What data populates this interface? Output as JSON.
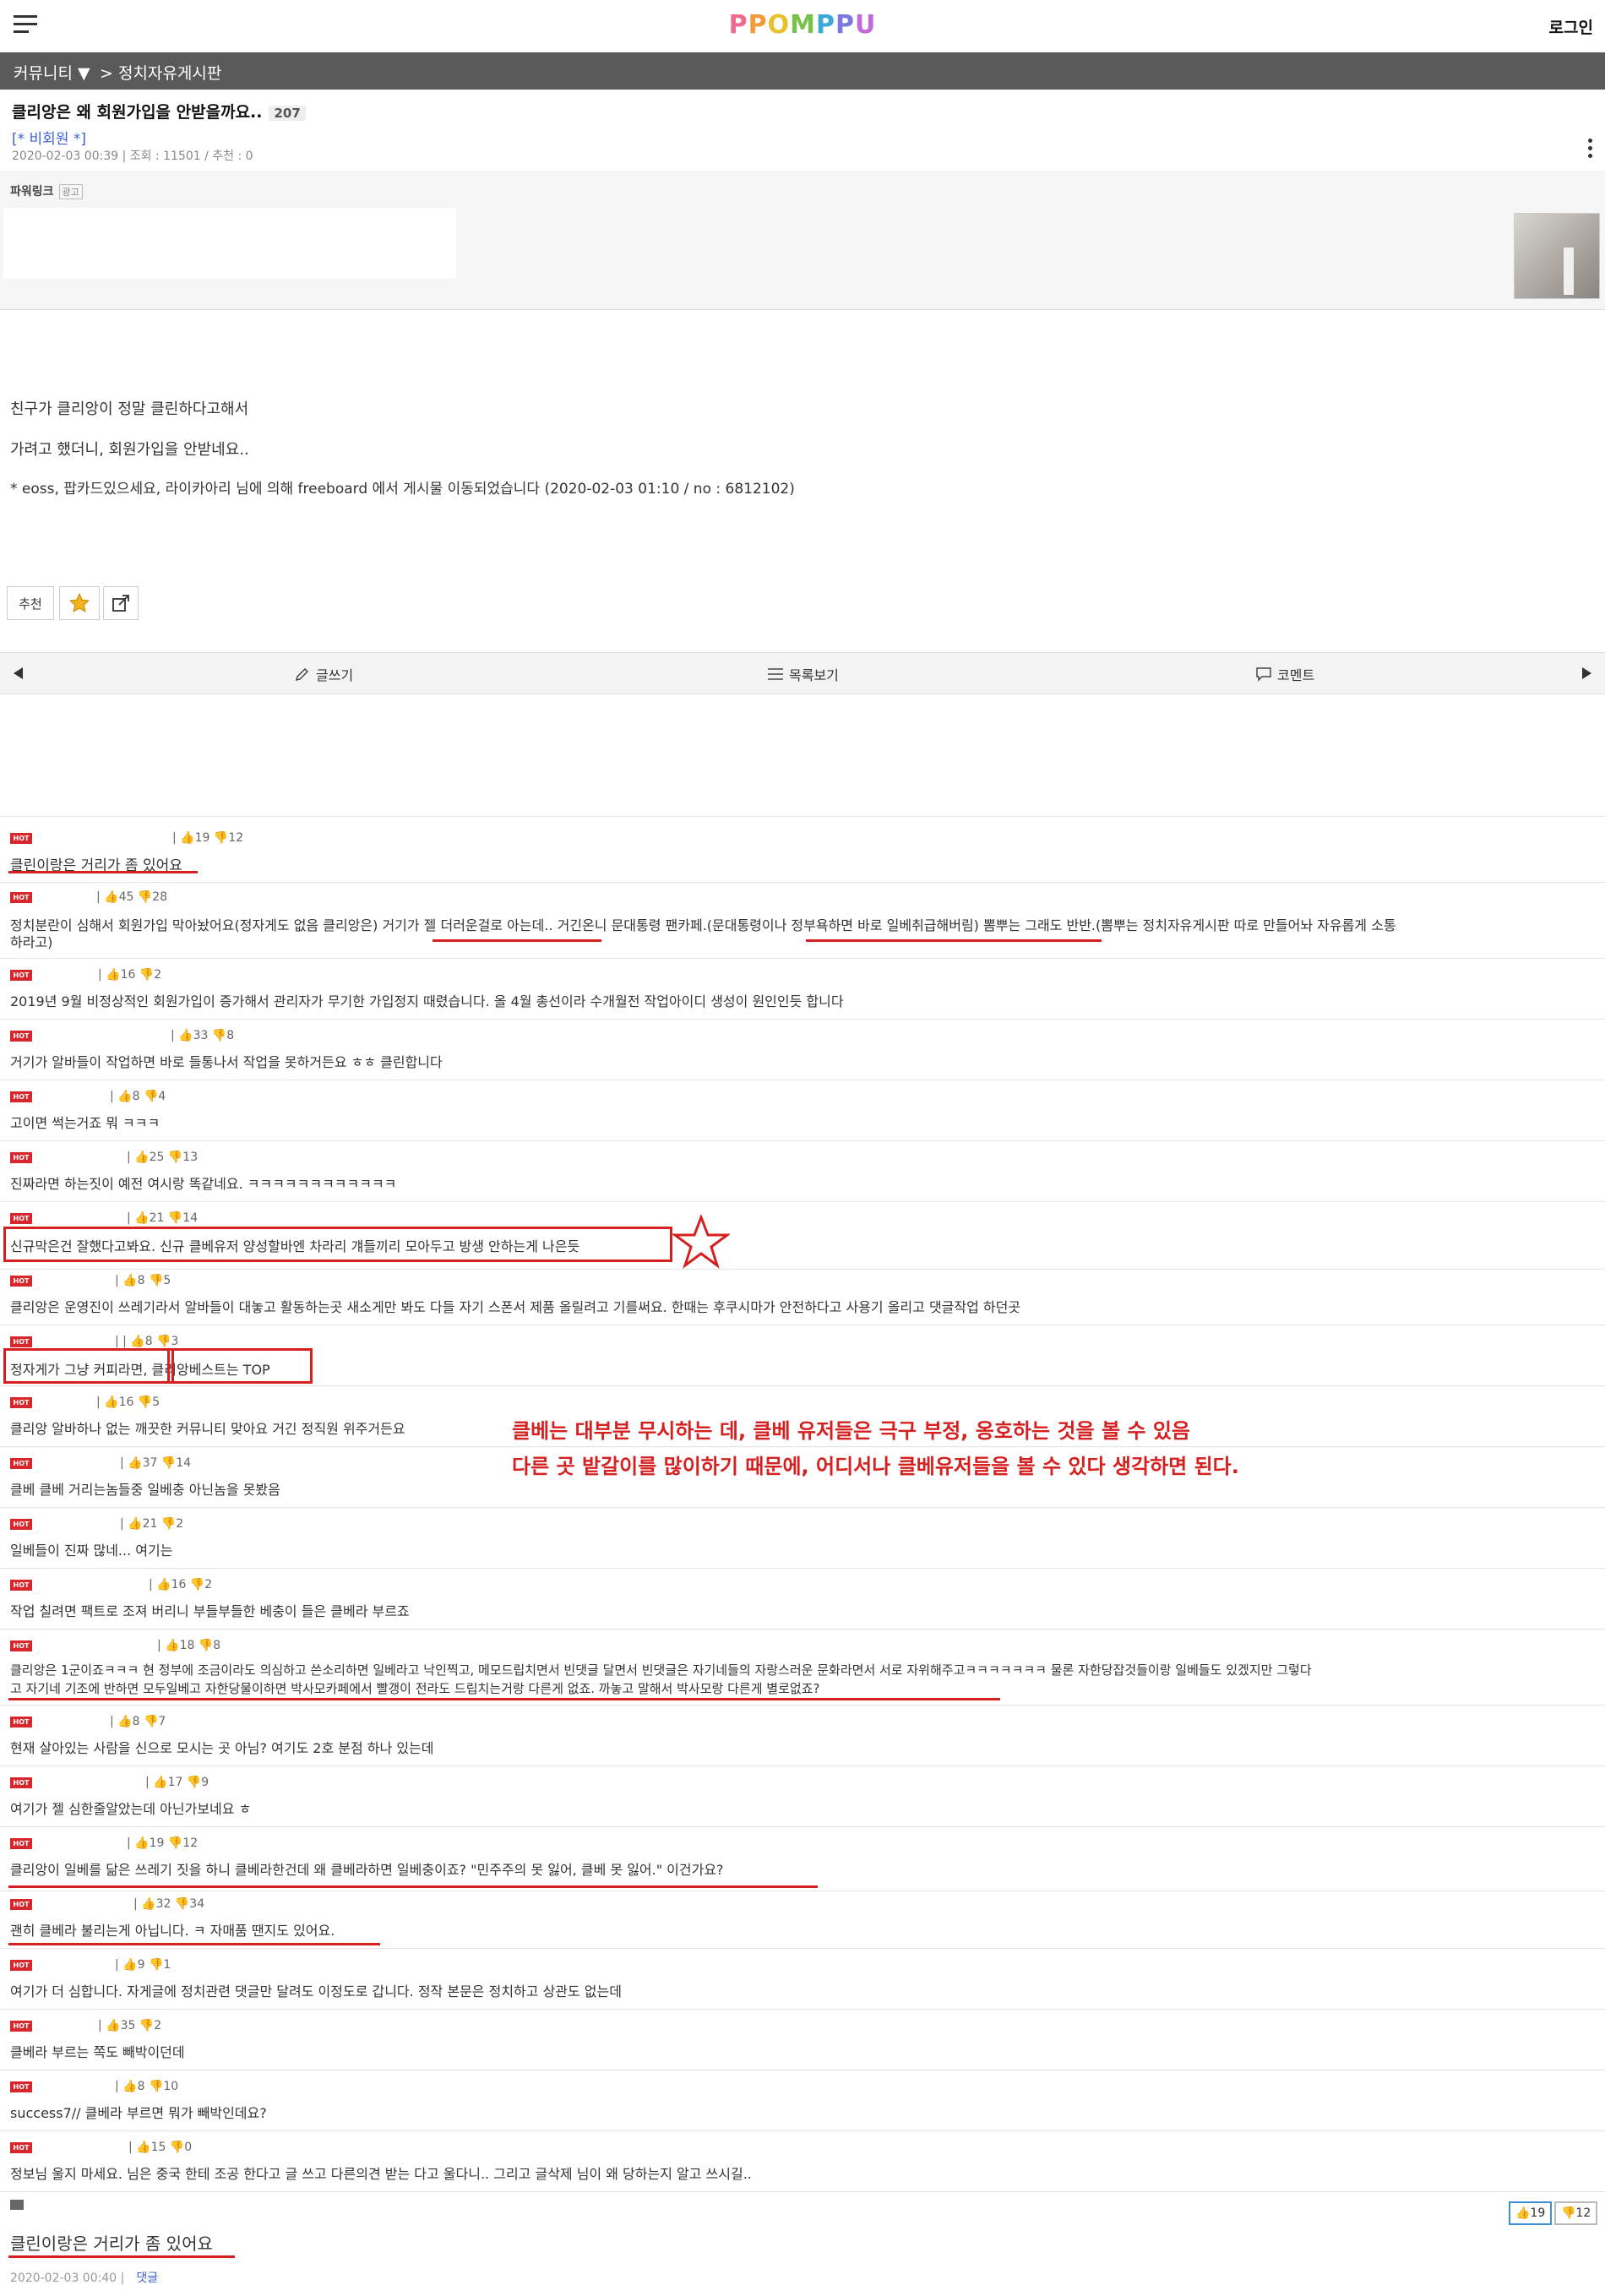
{
  "header": {
    "logo_text": "PPOMPPU",
    "login_label": "로그인",
    "brand_colors": [
      "#f06a8f",
      "#f29b3b",
      "#e7c22d",
      "#79c24a",
      "#3aa8d8",
      "#7b78e0",
      "#c06adb"
    ]
  },
  "breadcrumb": {
    "community": "커뮤니티 ▼",
    "board": "> 정치자유게시판"
  },
  "post": {
    "title": "클리앙은 왜 회원가입을 안받을까요..",
    "comment_count": "207",
    "author": "[* 비회원 *]",
    "meta": "2020-02-03 00:39 | 조회 : 11501 / 추천 : 0",
    "body": [
      "친구가 클리앙이 정말 클린하다고해서",
      "가려고 했더니, 회원가입을 안받네요..",
      "* eoss, 팝카드있으세요, 라이카아리 님에 의해 freeboard 에서 게시물 이동되었습니다 (2020-02-03 01:10 / no : 6812102)"
    ]
  },
  "ad": {
    "label": "파워링크",
    "tag": "광고"
  },
  "actions": {
    "recommend_label": "추천"
  },
  "nav": {
    "write_label": "글쓰기",
    "list_label": "목록보기",
    "comment_label": "코멘트"
  },
  "comments": [
    {
      "hot": "HOT",
      "votes": "| 👍19 👎12",
      "text": "클린이랑은 거리가 좀 있어요"
    },
    {
      "hot": "HOT",
      "votes": "| 👍45 👎28",
      "text": "정치분란이 심해서 회원가입 막아놨어요(정자게도 없음 클리앙은) 거기가 젤 더러운걸로 아는데.. 거긴온니 문대통령 팬카페.(문대통령이나 정부욕하면 바로 일베취급해버림) 뽐뿌는 그래도 반반.(뽐뿌는 정치자유게시판 따로 만들어놔 자유롭게 소통"
    },
    {
      "hot": "HOT",
      "votes": "| 👍16 👎2",
      "text": "2019년 9월 비정상적인 회원가입이 증가해서 관리자가 무기한 가입정지 때렸습니다. 올 4월 총선이라 수개월전 작업아이디 생성이 원인인듯 합니다"
    },
    {
      "hot": "HOT",
      "votes": "| 👍33 👎8",
      "text": "거기가 알바들이 작업하면 바로 들통나서 작업을 못하거든요 ㅎㅎ 클린합니다"
    },
    {
      "hot": "HOT",
      "votes": "| 👍8 👎4",
      "text": "고이면 썩는거죠 뭐 ㅋㅋㅋ"
    },
    {
      "hot": "HOT",
      "votes": "| 👍25 👎13",
      "text": "진짜라면 하는짓이 예전 여시랑 똑같네요. ㅋㅋㅋㅋㅋㅋㅋㅋㅋㅋㅋㅋ"
    },
    {
      "hot": "HOT",
      "votes": "| 👍21 👎14",
      "text": "신규막은건 잘했다고봐요. 신규 클베유저 양성할바엔 차라리 걔들끼리 모아두고 방생 안하는게 나은듯"
    },
    {
      "hot": "HOT",
      "votes": "| 👍8 👎5",
      "text": "클리앙은 운영진이 쓰레기라서 알바들이 대놓고 활동하는곳 새소게만 봐도 다들 자기 스폰서 제품 올릴려고 기를써요. 한때는 후쿠시마가 안전하다고 사용기 올리고 댓글작업 하던곳"
    },
    {
      "hot": "HOT",
      "votes": "| | 👍8 👎3",
      "text": "정자게가 그냥 커피라면, 클리앙베스트는 TOP"
    },
    {
      "hot": "HOT",
      "votes": "| 👍16 👎5",
      "text": "클리앙 알바하나 없는 깨끗한 커뮤니티 맞아요 거긴 정직원 위주거든요"
    },
    {
      "hot": "HOT",
      "votes": "| 👍37 👎14",
      "text": "클베 클베 거리는놈들중 일베충 아닌놈을 못봤음"
    },
    {
      "hot": "HOT",
      "votes": "| 👍21 👎2",
      "text": "일베들이 진짜 많네... 여기는"
    },
    {
      "hot": "HOT",
      "votes": "| 👍16 👎2",
      "text": "작업 칠려면 팩트로 조져 버리니 부들부들한 베충이 들은 클베라 부르죠"
    },
    {
      "hot": "HOT",
      "votes": "| 👍18 👎8",
      "text": "클리앙은 1군이죠ㅋㅋㅋ 현 정부에 조금이라도 의심하고 쓴소리하면 일베라고 낙인찍고, 메모드립치면서 빈댓글 달면서 빈댓글은 자기네들의 자랑스러운 문화라면서 서로 자위해주고ㅋㅋㅋㅋㅋㅋㅋ 물론 자한당잡것들이랑 일베들도 있겠지만 그렇다",
      "text2": "고 자기네 기조에 반하면 모두일베고 자한당물이하면 박사모카페에서 빨갱이 전라도 드립치는거랑 다른게 없죠. 까놓고 말해서 박사모랑 다른게 별로없죠?"
    },
    {
      "hot": "HOT",
      "votes": "| 👍8 👎7",
      "text": "현재 살아있는 사람을 신으로 모시는 곳 아님? 여기도 2호 분점 하나 있는데"
    },
    {
      "hot": "HOT",
      "votes": "| 👍17 👎9",
      "text": "여기가 젤 심한줄알았는데 아닌가보네요 ㅎ"
    },
    {
      "hot": "HOT",
      "votes": "| 👍19 👎12",
      "text": "클리앙이 일베를 닮은 쓰레기 짓을 하니 클베라한건데 왜 클베라하면 일베충이죠? \"민주주의 못 잃어, 클베 못 잃어.\" 이건가요?"
    },
    {
      "hot": "HOT",
      "votes": "| 👍32 👎34",
      "text": "괜히 클베라 불리는게 아닙니다. ㅋ 자매품 땐지도 있어요."
    },
    {
      "hot": "HOT",
      "votes": "| 👍9 👎1",
      "text": "여기가 더 심합니다. 자게글에 정치관련 댓글만 달려도 이정도로 갑니다. 정작 본문은 정치하고 상관도 없는데"
    },
    {
      "hot": "HOT",
      "votes": "| 👍35 👎2",
      "text": "클베라 부르는 쪽도 빼박이던데"
    },
    {
      "hot": "HOT",
      "votes": "| 👍8 👎10",
      "text": "success7// 클베라 부르면 뭐가 빼박인데요?"
    },
    {
      "hot": "HOT",
      "votes": "| 👍15 👎0",
      "text": "정보님 울지 마세요. 님은 중국 한테 조공 한다고 글 쓰고 다른의견 받는 다고 울다니.. 그리고 글삭제 님이 왜 당하는지 알고 쓰시길.."
    }
  ],
  "annotation": {
    "line1": "클베는 대부분 무시하는 데, 클베 유저들은 극구 부정, 옹호하는 것을 볼 수 있음",
    "line2": "다른 곳 밭갈이를 많이하기 때문에, 어디서나 클베유저들을 볼 수 있다 생각하면 된다.",
    "color": "#d62020"
  },
  "final": {
    "text": "클린이랑은 거리가 좀 있어요",
    "meta": "2020-02-03 00:40 |",
    "reply_label": "댓글",
    "up_votes": "👍19",
    "down_votes": "👎12"
  }
}
